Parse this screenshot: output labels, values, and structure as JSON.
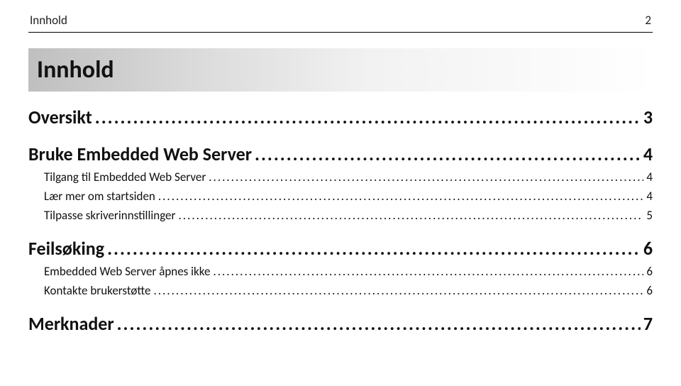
{
  "header": {
    "running_title": "Innhold",
    "page_number": "2"
  },
  "title": "Innhold",
  "toc": [
    {
      "level": 1,
      "label": "Oversikt",
      "page": "3"
    },
    {
      "level": 1,
      "label": "Bruke Embedded Web Server",
      "page": "4"
    },
    {
      "level": 2,
      "label": "Tilgang til Embedded Web Server",
      "page": "4"
    },
    {
      "level": 2,
      "label": "Lær mer om startsiden",
      "page": "4"
    },
    {
      "level": 2,
      "label": "Tilpasse skriverinnstillinger",
      "page": "5"
    },
    {
      "level": 1,
      "label": "Feilsøking",
      "page": "6"
    },
    {
      "level": 2,
      "label": "Embedded Web Server åpnes ikke",
      "page": "6"
    },
    {
      "level": 2,
      "label": "Kontakte brukerstøtte",
      "page": "6"
    },
    {
      "level": 1,
      "label": "Merknader",
      "page": "7"
    }
  ]
}
